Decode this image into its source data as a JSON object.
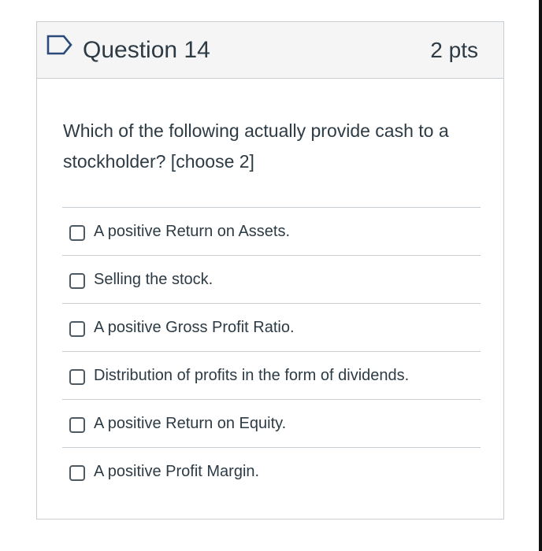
{
  "question": {
    "title": "Question 14",
    "points": "2 pts",
    "flag_icon": "flag-outline-icon",
    "text": "Which of the following actually provide cash to a stockholder? [choose 2]"
  },
  "answers": [
    {
      "label": "A positive Return on Assets.",
      "checked": false
    },
    {
      "label": "Selling the stock.",
      "checked": false
    },
    {
      "label": "A positive Gross Profit Ratio.",
      "checked": false
    },
    {
      "label": "Distribution of profits in the form of dividends.",
      "checked": false
    },
    {
      "label": "A positive Return on Equity.",
      "checked": false
    },
    {
      "label": "A positive Profit Margin.",
      "checked": false
    }
  ],
  "colors": {
    "text": "#2d3b45",
    "border": "#c7cdd1",
    "header_bg": "#f5f5f5",
    "flag": "#2b4a7a"
  }
}
